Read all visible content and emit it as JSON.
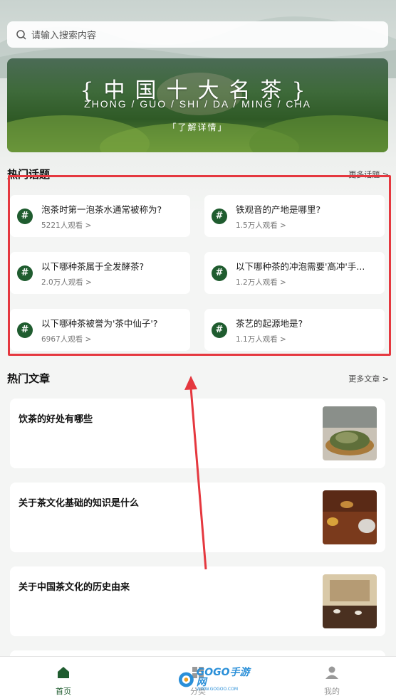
{
  "search": {
    "placeholder": "请输入搜索内容"
  },
  "banner": {
    "title": "{中国十大名茶}",
    "pinyin": "ZHONG / GUO / SHI / DA / MING / CHA",
    "link": "「了解详情」"
  },
  "hot_topics": {
    "title": "热门话题",
    "more": "更多话题 >",
    "items": [
      {
        "question": "泡茶时第一泡茶水通常被称为?",
        "views": "5221人观看 >"
      },
      {
        "question": "铁观音的产地是哪里?",
        "views": "1.5万人观看 >"
      },
      {
        "question": "以下哪种茶属于全发酵茶?",
        "views": "2.0万人观看 >"
      },
      {
        "question": "以下哪种茶的冲泡需要'高冲'手...",
        "views": "1.2万人观看 >"
      },
      {
        "question": "以下哪种茶被誉为'茶中仙子'?",
        "views": "6967人观看 >"
      },
      {
        "question": "茶艺的起源地是?",
        "views": "1.1万人观看 >"
      }
    ]
  },
  "hot_articles": {
    "title": "热门文章",
    "more": "更多文章 >",
    "items": [
      {
        "title": "饮茶的好处有哪些"
      },
      {
        "title": "关于茶文化基础的知识是什么"
      },
      {
        "title": "关于中国茶文化的历史由来"
      }
    ]
  },
  "tabbar": {
    "home": "首页",
    "category": "分类",
    "mine": "我的"
  },
  "watermark": {
    "brand": "GOGO手游网",
    "url": "WWW.GOGOO.COM"
  },
  "colors": {
    "accent": "#1f5c2f",
    "highlight": "#e5383f"
  }
}
